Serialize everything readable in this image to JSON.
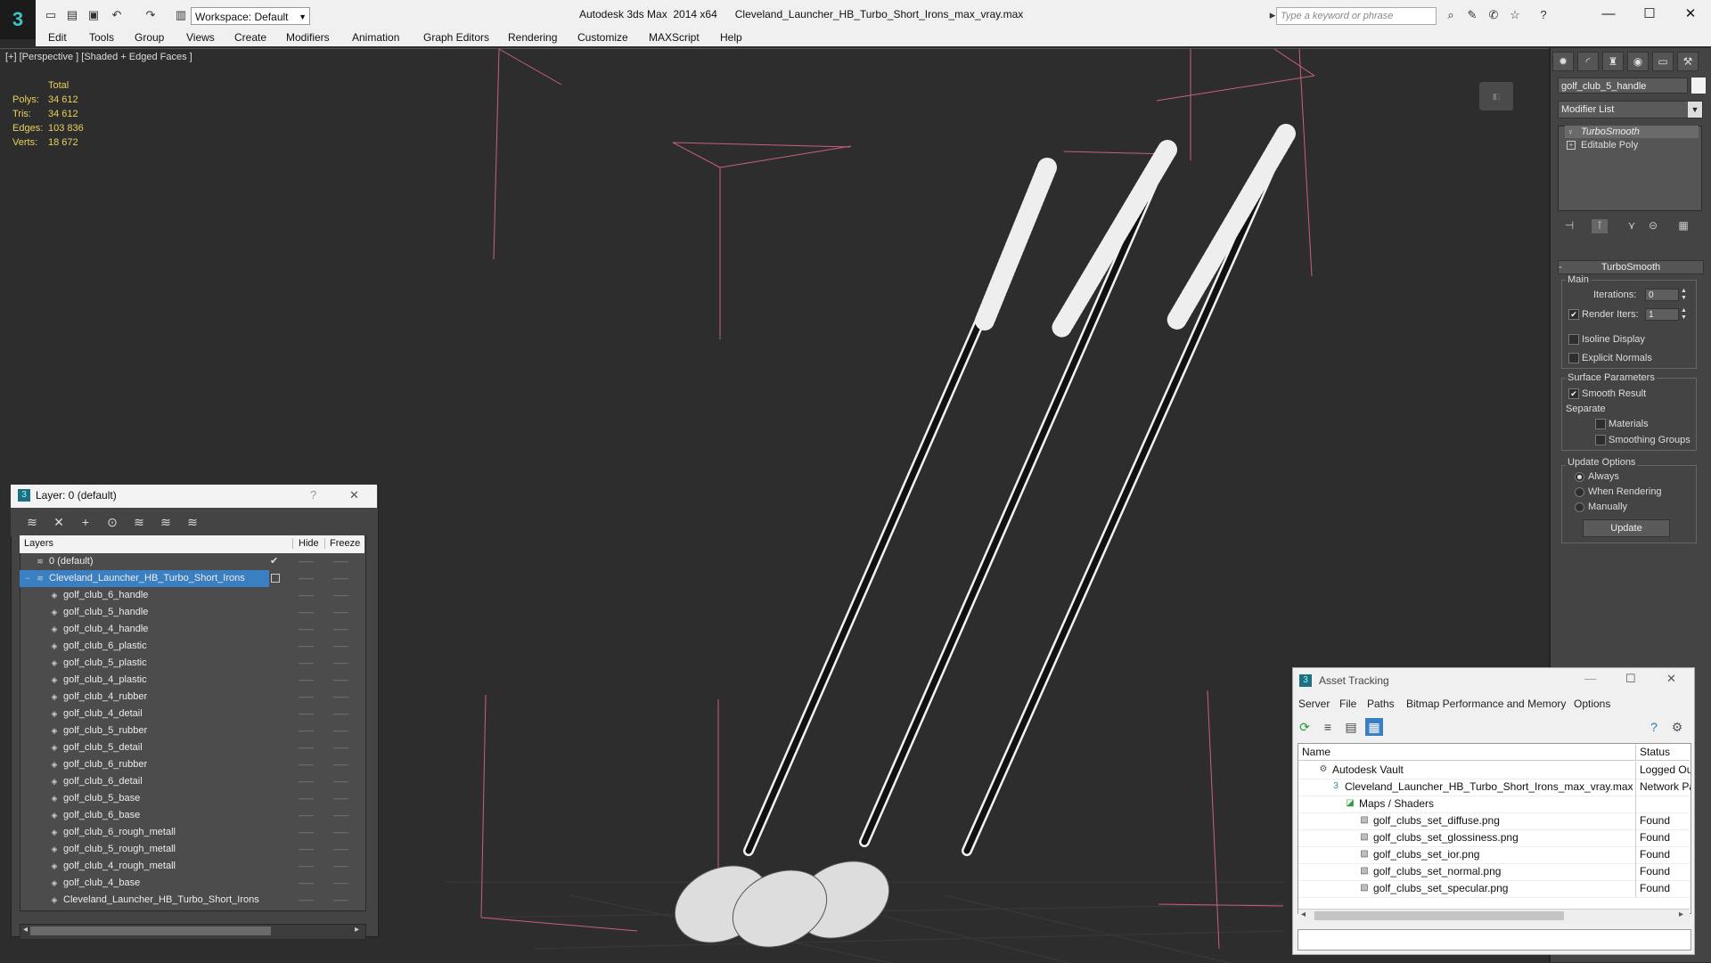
{
  "window": {
    "app_title": "Autodesk 3ds Max  2014 x64      Cleveland_Launcher_HB_Turbo_Short_Irons_max_vray.max",
    "workspace": "Workspace: Default",
    "search_placeholder": "Type a keyword or phrase"
  },
  "menu": [
    "Edit",
    "Tools",
    "Group",
    "Views",
    "Create",
    "Modifiers",
    "Animation",
    "Graph Editors",
    "Rendering",
    "Customize",
    "MAXScript",
    "Help"
  ],
  "viewport": {
    "label": "[+] [Perspective ] [Shaded + Edged Faces ]",
    "stats": {
      "header": "Total",
      "rows": [
        {
          "k": "Polys:",
          "v": "34 612"
        },
        {
          "k": "Tris:",
          "v": "34 612"
        },
        {
          "k": "Edges:",
          "v": "103 836"
        },
        {
          "k": "Verts:",
          "v": "18 672"
        }
      ]
    }
  },
  "command_panel": {
    "object_name": "golf_club_5_handle",
    "modifier_list": "Modifier List",
    "stack": [
      "TurboSmooth",
      "Editable Poly"
    ],
    "rollout_title": "TurboSmooth",
    "main_group": "Main",
    "iterations_label": "Iterations:",
    "iterations_value": "0",
    "render_iters_label": "Render Iters:",
    "render_iters_value": "1",
    "render_iters_checked": true,
    "isoline_display": "Isoline Display",
    "explicit_normals": "Explicit Normals",
    "surface_params": "Surface Parameters",
    "smooth_result": "Smooth Result",
    "separate": "Separate",
    "materials": "Materials",
    "smoothing_groups": "Smoothing Groups",
    "update_options": "Update Options",
    "always": "Always",
    "when_rendering": "When Rendering",
    "manually": "Manually",
    "update_button": "Update"
  },
  "layer_dialog": {
    "title": "Layer: 0 (default)",
    "help": "?",
    "close": "✕",
    "col_layers": "Layers",
    "col_hide": "Hide",
    "col_freeze": "Freeze",
    "rows": [
      "0 (default)",
      "Cleveland_Launcher_HB_Turbo_Short_Irons",
      "golf_club_6_handle",
      "golf_club_5_handle",
      "golf_club_4_handle",
      "golf_club_6_plastic",
      "golf_club_5_plastic",
      "golf_club_4_plastic",
      "golf_club_4_rubber",
      "golf_club_4_detail",
      "golf_club_5_rubber",
      "golf_club_5_detail",
      "golf_club_6_rubber",
      "golf_club_6_detail",
      "golf_club_5_base",
      "golf_club_6_base",
      "golf_club_6_rough_metall",
      "golf_club_5_rough_metall",
      "golf_club_4_rough_metall",
      "golf_club_4_base",
      "Cleveland_Launcher_HB_Turbo_Short_Irons"
    ]
  },
  "asset_tracking": {
    "title": "Asset Tracking",
    "menu": [
      "Server",
      "File",
      "Paths",
      "Bitmap Performance and Memory",
      "Options"
    ],
    "col_name": "Name",
    "col_status": "Status",
    "rows": [
      {
        "name": "Autodesk Vault",
        "status": "Logged Out"
      },
      {
        "name": "Cleveland_Launcher_HB_Turbo_Short_Irons_max_vray.max",
        "status": "Network Path"
      },
      {
        "name": "Maps / Shaders",
        "status": ""
      },
      {
        "name": "golf_clubs_set_diffuse.png",
        "status": "Found"
      },
      {
        "name": "golf_clubs_set_glossiness.png",
        "status": "Found"
      },
      {
        "name": "golf_clubs_set_ior.png",
        "status": "Found"
      },
      {
        "name": "golf_clubs_set_normal.png",
        "status": "Found"
      },
      {
        "name": "golf_clubs_set_specular.png",
        "status": "Found"
      }
    ]
  }
}
